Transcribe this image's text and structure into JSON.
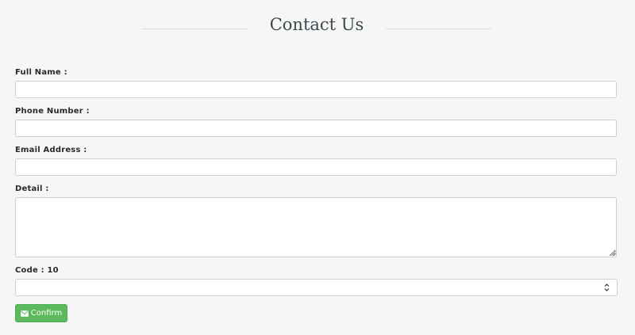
{
  "page": {
    "title": "Contact Us"
  },
  "form": {
    "full_name": {
      "label": "Full Name :",
      "value": "",
      "placeholder": ""
    },
    "phone": {
      "label": "Phone Number :",
      "value": "",
      "placeholder": ""
    },
    "email": {
      "label": "Email Address :",
      "value": "",
      "placeholder": ""
    },
    "detail": {
      "label": "Detail :",
      "value": "",
      "placeholder": ""
    },
    "code": {
      "label": "Code : 10",
      "selected": ""
    },
    "confirm_label": "Confirm"
  },
  "icons": {
    "confirm": "envelope-icon",
    "select": "chevron-up-down-icon"
  },
  "colors": {
    "background": "#f6f6f6",
    "title": "#3c4a4f",
    "confirm_button": "#5cb85c"
  }
}
